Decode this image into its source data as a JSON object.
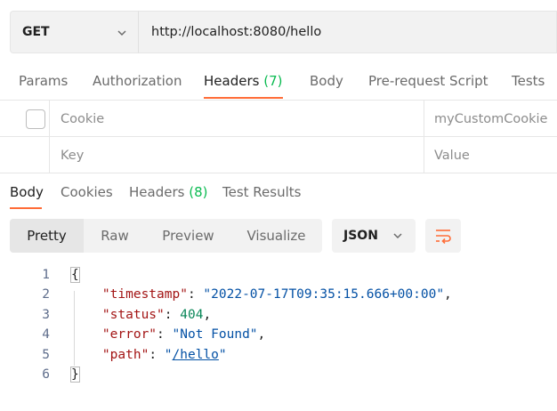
{
  "request": {
    "method": "GET",
    "url": "http://localhost:8080/hello"
  },
  "request_tabs": {
    "params": "Params",
    "authorization": "Authorization",
    "headers": "Headers",
    "headers_count": "(7)",
    "body": "Body",
    "prerequest": "Pre-request Script",
    "tests": "Tests"
  },
  "header_rows": [
    {
      "key": "Cookie",
      "value": "myCustomCookie"
    },
    {
      "key": "Key",
      "value": "Value"
    }
  ],
  "response_tabs": {
    "body": "Body",
    "cookies": "Cookies",
    "headers": "Headers",
    "headers_count": "(8)",
    "test_results": "Test Results"
  },
  "view_modes": {
    "pretty": "Pretty",
    "raw": "Raw",
    "preview": "Preview",
    "visualize": "Visualize"
  },
  "format": "JSON",
  "code": {
    "line_numbers": [
      "1",
      "2",
      "3",
      "4",
      "5",
      "6"
    ],
    "open_brace": "{",
    "close_brace": "}",
    "timestamp_key": "\"timestamp\"",
    "timestamp_value": "\"2022-07-17T09:35:15.666+00:00\"",
    "status_key": "\"status\"",
    "status_value": "404",
    "error_key": "\"error\"",
    "error_value": "\"Not Found\"",
    "path_key": "\"path\"",
    "path_value_quote": "\"",
    "path_value_link": "/hello"
  },
  "colors": {
    "accent": "#ff6c37",
    "count_green": "#0cbb52"
  }
}
